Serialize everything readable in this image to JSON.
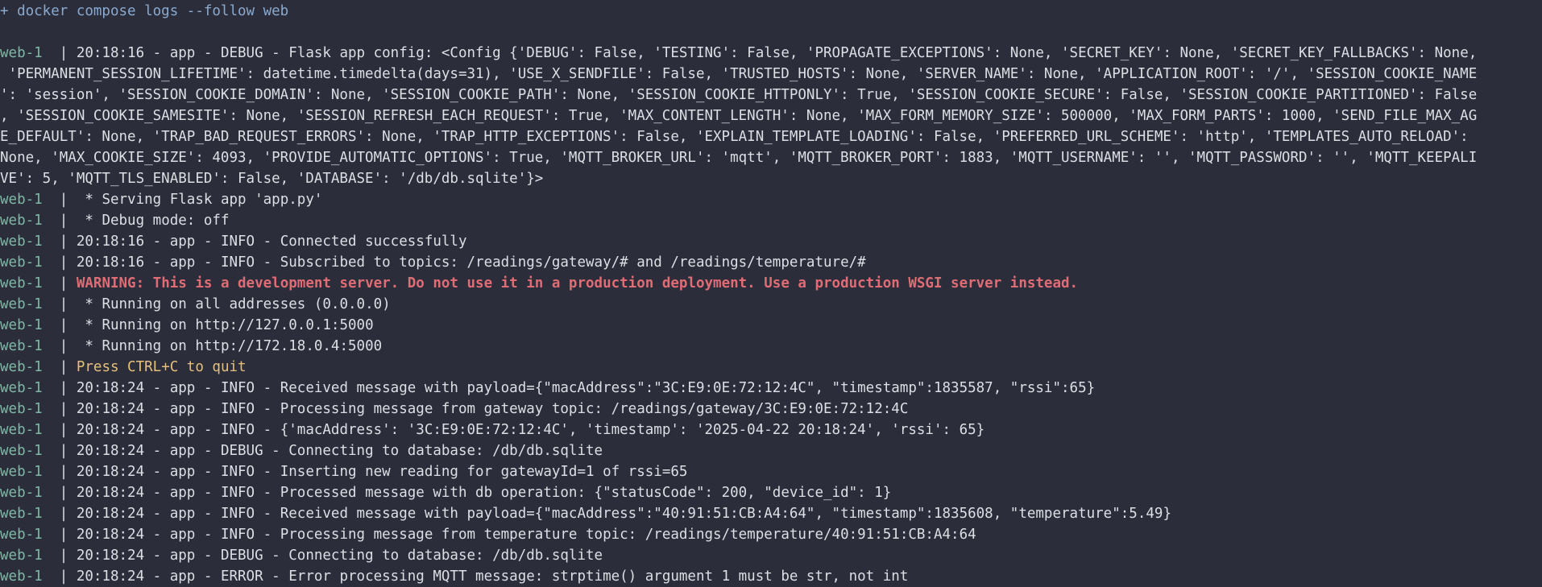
{
  "terminal": {
    "command": "+ docker compose logs --follow web",
    "colors": {
      "background": "#2b2d3a",
      "text": "#dcdfe4",
      "command": "#8aa9cf",
      "service_prefix": "#7fb8a4",
      "warning": "#e06c75",
      "highlight": "#e5c07b"
    },
    "lines": [
      {
        "prefix": "web-1  ",
        "sep": "| ",
        "text": "20:18:16 - app - DEBUG - Flask app config: <Config {'DEBUG': False, 'TESTING': False, 'PROPAGATE_EXCEPTIONS': None, 'SECRET_KEY': None, 'SECRET_KEY_FALLBACKS': None,",
        "style": "normal"
      },
      {
        "prefix": "",
        "sep": "",
        "text": " 'PERMANENT_SESSION_LIFETIME': datetime.timedelta(days=31), 'USE_X_SENDFILE': False, 'TRUSTED_HOSTS': None, 'SERVER_NAME': None, 'APPLICATION_ROOT': '/', 'SESSION_COOKIE_NAME",
        "style": "normal"
      },
      {
        "prefix": "",
        "sep": "",
        "text": "': 'session', 'SESSION_COOKIE_DOMAIN': None, 'SESSION_COOKIE_PATH': None, 'SESSION_COOKIE_HTTPONLY': True, 'SESSION_COOKIE_SECURE': False, 'SESSION_COOKIE_PARTITIONED': False",
        "style": "normal"
      },
      {
        "prefix": "",
        "sep": "",
        "text": ", 'SESSION_COOKIE_SAMESITE': None, 'SESSION_REFRESH_EACH_REQUEST': True, 'MAX_CONTENT_LENGTH': None, 'MAX_FORM_MEMORY_SIZE': 500000, 'MAX_FORM_PARTS': 1000, 'SEND_FILE_MAX_AG",
        "style": "normal"
      },
      {
        "prefix": "",
        "sep": "",
        "text": "E_DEFAULT': None, 'TRAP_BAD_REQUEST_ERRORS': None, 'TRAP_HTTP_EXCEPTIONS': False, 'EXPLAIN_TEMPLATE_LOADING': False, 'PREFERRED_URL_SCHEME': 'http', 'TEMPLATES_AUTO_RELOAD':",
        "style": "normal"
      },
      {
        "prefix": "",
        "sep": "",
        "text": "None, 'MAX_COOKIE_SIZE': 4093, 'PROVIDE_AUTOMATIC_OPTIONS': True, 'MQTT_BROKER_URL': 'mqtt', 'MQTT_BROKER_PORT': 1883, 'MQTT_USERNAME': '', 'MQTT_PASSWORD': '', 'MQTT_KEEPALI",
        "style": "normal"
      },
      {
        "prefix": "",
        "sep": "",
        "text": "VE': 5, 'MQTT_TLS_ENABLED': False, 'DATABASE': '/db/db.sqlite'}>",
        "style": "normal"
      },
      {
        "prefix": "web-1  ",
        "sep": "| ",
        "text": " * Serving Flask app 'app.py'",
        "style": "normal"
      },
      {
        "prefix": "web-1  ",
        "sep": "| ",
        "text": " * Debug mode: off",
        "style": "normal"
      },
      {
        "prefix": "web-1  ",
        "sep": "| ",
        "text": "20:18:16 - app - INFO - Connected successfully",
        "style": "normal"
      },
      {
        "prefix": "web-1  ",
        "sep": "| ",
        "text": "20:18:16 - app - INFO - Subscribed to topics: /readings/gateway/# and /readings/temperature/#",
        "style": "normal"
      },
      {
        "prefix": "web-1  ",
        "sep": "| ",
        "text": "WARNING: This is a development server. Do not use it in a production deployment. Use a production WSGI server instead.",
        "style": "warn"
      },
      {
        "prefix": "web-1  ",
        "sep": "| ",
        "text": " * Running on all addresses (0.0.0.0)",
        "style": "normal"
      },
      {
        "prefix": "web-1  ",
        "sep": "| ",
        "text": " * Running on http://127.0.0.1:5000",
        "style": "normal"
      },
      {
        "prefix": "web-1  ",
        "sep": "| ",
        "text": " * Running on http://172.18.0.4:5000",
        "style": "normal"
      },
      {
        "prefix": "web-1  ",
        "sep": "| ",
        "text": "Press CTRL+C to quit",
        "style": "quit"
      },
      {
        "prefix": "web-1  ",
        "sep": "| ",
        "text": "20:18:24 - app - INFO - Received message with payload={\"macAddress\":\"3C:E9:0E:72:12:4C\", \"timestamp\":1835587, \"rssi\":65}",
        "style": "normal"
      },
      {
        "prefix": "web-1  ",
        "sep": "| ",
        "text": "20:18:24 - app - INFO - Processing message from gateway topic: /readings/gateway/3C:E9:0E:72:12:4C",
        "style": "normal"
      },
      {
        "prefix": "web-1  ",
        "sep": "| ",
        "text": "20:18:24 - app - INFO - {'macAddress': '3C:E9:0E:72:12:4C', 'timestamp': '2025-04-22 20:18:24', 'rssi': 65}",
        "style": "normal"
      },
      {
        "prefix": "web-1  ",
        "sep": "| ",
        "text": "20:18:24 - app - DEBUG - Connecting to database: /db/db.sqlite",
        "style": "normal"
      },
      {
        "prefix": "web-1  ",
        "sep": "| ",
        "text": "20:18:24 - app - INFO - Inserting new reading for gatewayId=1 of rssi=65",
        "style": "normal"
      },
      {
        "prefix": "web-1  ",
        "sep": "| ",
        "text": "20:18:24 - app - INFO - Processed message with db operation: {\"statusCode\": 200, \"device_id\": 1}",
        "style": "normal"
      },
      {
        "prefix": "web-1  ",
        "sep": "| ",
        "text": "20:18:24 - app - INFO - Received message with payload={\"macAddress\":\"40:91:51:CB:A4:64\", \"timestamp\":1835608, \"temperature\":5.49}",
        "style": "normal"
      },
      {
        "prefix": "web-1  ",
        "sep": "| ",
        "text": "20:18:24 - app - INFO - Processing message from temperature topic: /readings/temperature/40:91:51:CB:A4:64",
        "style": "normal"
      },
      {
        "prefix": "web-1  ",
        "sep": "| ",
        "text": "20:18:24 - app - DEBUG - Connecting to database: /db/db.sqlite",
        "style": "normal"
      },
      {
        "prefix": "web-1  ",
        "sep": "| ",
        "text": "20:18:24 - app - ERROR - Error processing MQTT message: strptime() argument 1 must be str, not int",
        "style": "normal"
      }
    ]
  }
}
